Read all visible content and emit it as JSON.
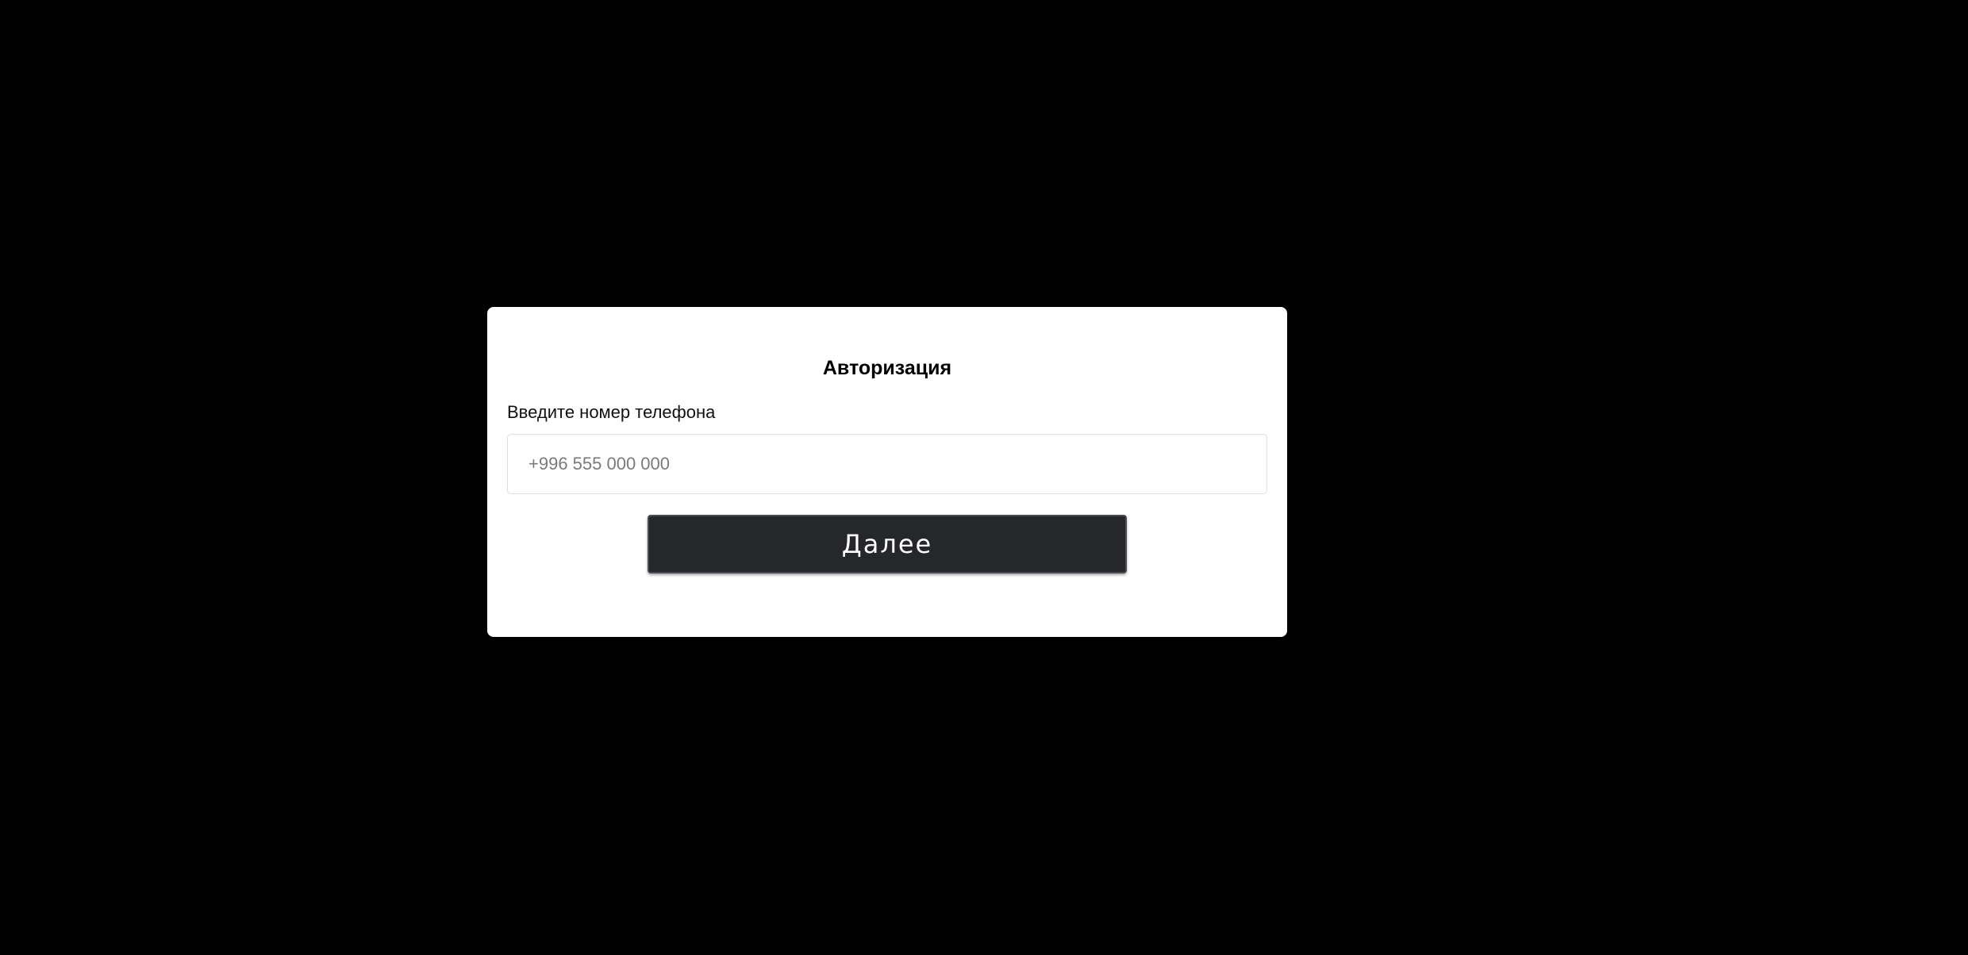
{
  "colors": {
    "background": "#000000",
    "modal_background": "#ffffff",
    "button_background": "#26272b",
    "button_text": "#ffffff"
  },
  "auth": {
    "title": "Авторизация",
    "phone_label": "Введите номер телефона",
    "phone_value": "",
    "phone_placeholder": "+996 555 000 000",
    "submit_label": "Далее"
  }
}
